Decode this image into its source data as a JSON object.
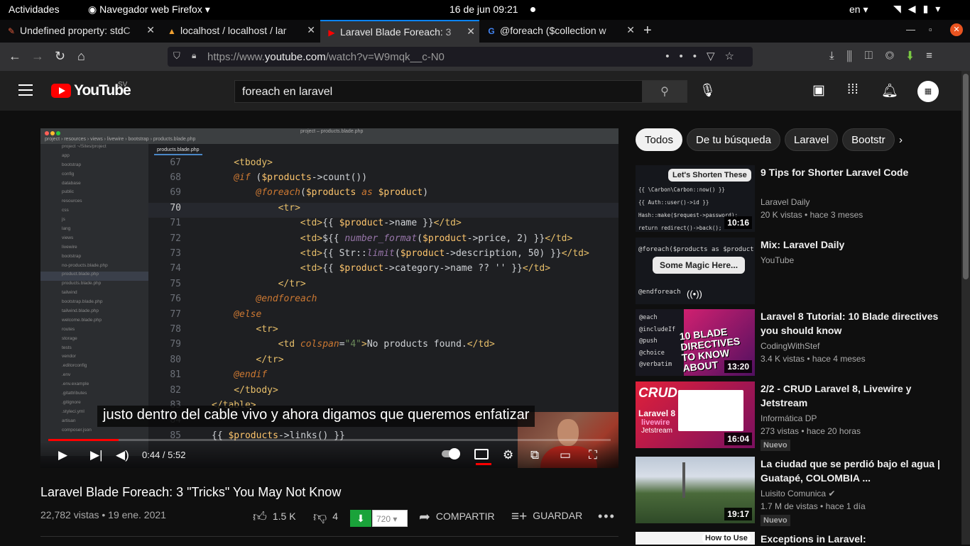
{
  "gnome": {
    "activities": "Actividades",
    "app": "Navegador web Firefox ▾",
    "clock": "16 de jun  09:21",
    "lang": "en ▾"
  },
  "browser": {
    "tabs": [
      {
        "label": "Undefined property: stdC",
        "favicon": "✎"
      },
      {
        "label": "localhost / localhost / lar",
        "favicon": "▲"
      },
      {
        "label": "Laravel Blade Foreach: 3",
        "favicon": "▶",
        "active": true
      },
      {
        "label": "@foreach ($collection w",
        "favicon": "G"
      }
    ],
    "url_prefix": "https://www.",
    "url_host": "youtube.com",
    "url_path": "/watch?v=W9mqk__c-N0"
  },
  "youtube": {
    "logo_text": "YouTube",
    "country": "SV",
    "search_query": "foreach en laravel"
  },
  "player": {
    "ide_title": "project – products.blade.php",
    "ide_crumbs": "project › resources › views › livewire › bootstrap › products.blade.php",
    "ide_tab": "products.blade.php",
    "tree": [
      "project ~/Sites/project",
      "app",
      "bootstrap",
      "config",
      "database",
      "public",
      "resources",
      "css",
      "js",
      "lang",
      "views",
      "livewire",
      "bootstrap",
      "no-products.blade.php",
      "product.blade.php",
      "products.blade.php",
      "tailwind",
      "bootstrap.blade.php",
      "tailwind.blade.php",
      "welcome.blade.php",
      "routes",
      "storage",
      "tests",
      "vendor",
      ".editorconfig",
      ".env",
      ".env.example",
      ".gitattributes",
      ".gitignore",
      ".styleci.yml",
      "artisan",
      "composer.json"
    ],
    "code": [
      {
        "n": "67",
        "indent": 4,
        "html": "<span class='tag'>&lt;tbody&gt;</span>"
      },
      {
        "n": "68",
        "indent": 4,
        "html": "<span class='kw'>@if</span> (<span class='var'>$products</span>-&gt;count())"
      },
      {
        "n": "69",
        "indent": 8,
        "html": "<span class='kw'>@foreach</span>(<span class='var'>$products</span> <span class='kw'>as</span> <span class='var'>$product</span>)"
      },
      {
        "n": "70",
        "indent": 12,
        "html": "<span class='tag'>&lt;tr&gt;</span>",
        "cur": true
      },
      {
        "n": "71",
        "indent": 16,
        "html": "<span class='tag'>&lt;td&gt;</span>{{ <span class='var'>$product</span>-&gt;name }}<span class='tag'>&lt;/td&gt;</span>"
      },
      {
        "n": "72",
        "indent": 16,
        "html": "<span class='tag'>&lt;td&gt;</span>${{ <span class='fn'>number_format</span>(<span class='var'>$product</span>-&gt;price, 2) }}<span class='tag'>&lt;/td&gt;</span>"
      },
      {
        "n": "73",
        "indent": 16,
        "html": "<span class='tag'>&lt;td&gt;</span>{{ Str::<span class='fn'>limit</span>(<span class='var'>$product</span>-&gt;description, 50) }}<span class='tag'>&lt;/td&gt;</span>"
      },
      {
        "n": "74",
        "indent": 16,
        "html": "<span class='tag'>&lt;td&gt;</span>{{ <span class='var'>$product</span>-&gt;category-&gt;name ?? '' }}<span class='tag'>&lt;/td&gt;</span>"
      },
      {
        "n": "75",
        "indent": 12,
        "html": "<span class='tag'>&lt;/tr&gt;</span>"
      },
      {
        "n": "76",
        "indent": 8,
        "html": "<span class='kw'>@endforeach</span>"
      },
      {
        "n": "77",
        "indent": 4,
        "html": "<span class='kw'>@else</span>"
      },
      {
        "n": "78",
        "indent": 8,
        "html": "<span class='tag'>&lt;tr&gt;</span>"
      },
      {
        "n": "79",
        "indent": 12,
        "html": "<span class='tag'>&lt;td</span> <span class='kw'>colspan</span>=<span class='str'>\"4\"</span><span class='tag'>&gt;</span>No products found.<span class='tag'>&lt;/td&gt;</span>"
      },
      {
        "n": "80",
        "indent": 8,
        "html": "<span class='tag'>&lt;/tr&gt;</span>"
      },
      {
        "n": "81",
        "indent": 4,
        "html": "<span class='kw'>@endif</span>"
      },
      {
        "n": "82",
        "indent": 4,
        "html": "<span class='tag'>&lt;/tbody&gt;</span>"
      },
      {
        "n": "83",
        "indent": 0,
        "html": "<span class='tag'>&lt;/table&gt;</span>"
      },
      {
        "n": "84",
        "indent": 0,
        "html": ""
      },
      {
        "n": "85",
        "indent": 0,
        "html": "{{ <span class='var'>$products</span>-&gt;links() }}"
      }
    ],
    "caption": "justo dentro del cable vivo y ahora digamos que queremos enfatizar",
    "time": "0:44 / 5:52",
    "progress": 0.125
  },
  "video": {
    "title": "Laravel Blade Foreach: 3 \"Tricks\" You May Not Know",
    "meta": "22,782 vistas • 19 ene. 2021",
    "likes": "1.5 K",
    "dislikes": "4",
    "quality": "720",
    "share": "COMPARTIR",
    "save": "GUARDAR"
  },
  "chips": [
    "Todos",
    "De tu búsqueda",
    "Laravel",
    "Bootstr"
  ],
  "recs": [
    {
      "title": "9 Tips for Shorter Laravel Code",
      "channel": "Laravel Daily",
      "stats": "20 K vistas • hace 3 meses",
      "dur": "10:16",
      "pill": "Let's Shorten These",
      "code": "{{ \\Carbon\\Carbon::now() }}\n\n{{ Auth::user()->id }}\n\nHash::make($request->password);\n\nreturn redirect()->back();"
    },
    {
      "title": "Mix: Laravel Daily",
      "channel": "YouTube",
      "stats": "",
      "dur": "",
      "pill": "Some Magic Here...",
      "code": "@foreach($products as $product)\n\n\n\n\n\n@endforeach"
    },
    {
      "title": "Laravel 8 Tutorial: 10 Blade directives you should know",
      "channel": "CodingWithStef",
      "stats": "3.4 K vistas • hace 4 meses",
      "dur": "13:20",
      "pill": "",
      "code": "@each\n\n@includeIf\n\n@push\n\n@choice\n\n@verbatim"
    },
    {
      "title": "2/2 - CRUD Laravel 8, Livewire y Jetstream",
      "channel": "Informática DP",
      "stats": "273 vistas • hace 20 horas",
      "dur": "16:04",
      "badge": "Nuevo",
      "pill": "",
      "code": ""
    },
    {
      "title": "La ciudad que se perdió bajo el agua | Guatapé, COLOMBIA ...",
      "channel": "Luisito Comunica ✔",
      "stats": "1.7 M de vistas • hace 1 día",
      "dur": "19:17",
      "badge": "Nuevo",
      "pill": "",
      "code": ""
    },
    {
      "title": "Exceptions in Laravel:",
      "channel": "",
      "stats": "",
      "dur": "",
      "pill": "How to Use",
      "code": ""
    }
  ],
  "thumb_texts": {
    "blade_title": "10 BLADE DIRECTIVES TO KNOW ABOUT",
    "crud": "CRUD",
    "laravel8": "Laravel 8",
    "livewire": "livewire",
    "jetstream": "Jetstream"
  }
}
